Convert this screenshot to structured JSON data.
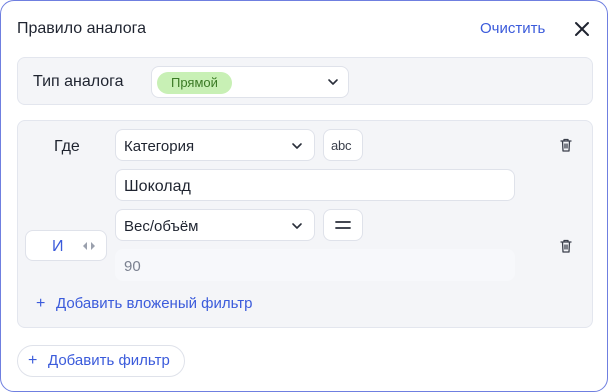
{
  "dialog": {
    "title": "Правило аналога",
    "clear_label": "Очистить",
    "close_icon": "close-icon"
  },
  "analog_type": {
    "label": "Тип аналога",
    "selected": "Прямой",
    "pill_color": "#c8f0b5"
  },
  "filter": {
    "where_label": "Где",
    "condition1": {
      "field": "Категория",
      "operator_icon": "text-contains-icon",
      "operator_text": "abc",
      "value": "Шоколад"
    },
    "connector": "И",
    "condition2": {
      "field": "Вес/объём",
      "operator_icon": "equals-icon",
      "value": "90"
    },
    "add_nested_label": "Добавить вложеный фильтр"
  },
  "add_filter_label": "Добавить фильтр",
  "colors": {
    "accent": "#3b5bdb",
    "panel_bg": "#f4f5f8",
    "border": "#6f7fe0"
  }
}
